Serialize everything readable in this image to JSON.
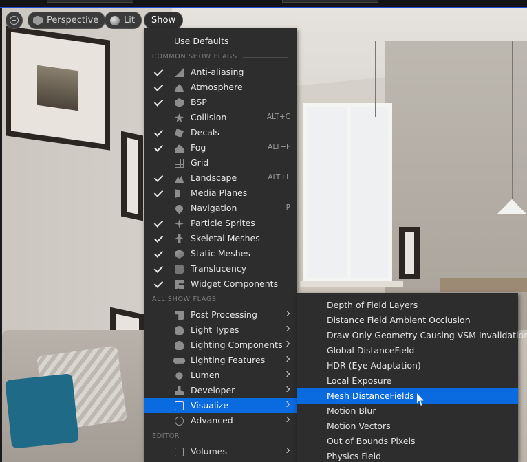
{
  "toolbar": {
    "perspective_label": "Perspective",
    "lit_label": "Lit",
    "show_label": "Show"
  },
  "menu": {
    "use_defaults": "Use Defaults",
    "section_common": "COMMON SHOW FLAGS",
    "common_items": [
      {
        "label": "Anti-aliasing",
        "checked": true,
        "shortcut": "",
        "icon": "anti-aliasing-icon"
      },
      {
        "label": "Atmosphere",
        "checked": true,
        "shortcut": "",
        "icon": "atmosphere-icon"
      },
      {
        "label": "BSP",
        "checked": true,
        "shortcut": "",
        "icon": "bsp-icon"
      },
      {
        "label": "Collision",
        "checked": false,
        "shortcut": "ALT+C",
        "icon": "collision-icon"
      },
      {
        "label": "Decals",
        "checked": true,
        "shortcut": "",
        "icon": "decals-icon"
      },
      {
        "label": "Fog",
        "checked": true,
        "shortcut": "ALT+F",
        "icon": "fog-icon"
      },
      {
        "label": "Grid",
        "checked": false,
        "shortcut": "",
        "icon": "grid-icon"
      },
      {
        "label": "Landscape",
        "checked": true,
        "shortcut": "ALT+L",
        "icon": "landscape-icon"
      },
      {
        "label": "Media Planes",
        "checked": true,
        "shortcut": "",
        "icon": "media-planes-icon"
      },
      {
        "label": "Navigation",
        "checked": false,
        "shortcut": "P",
        "icon": "navigation-icon"
      },
      {
        "label": "Particle Sprites",
        "checked": true,
        "shortcut": "",
        "icon": "particle-sprites-icon"
      },
      {
        "label": "Skeletal Meshes",
        "checked": true,
        "shortcut": "",
        "icon": "skeletal-meshes-icon"
      },
      {
        "label": "Static Meshes",
        "checked": true,
        "shortcut": "",
        "icon": "static-meshes-icon"
      },
      {
        "label": "Translucency",
        "checked": true,
        "shortcut": "",
        "icon": "translucency-icon"
      },
      {
        "label": "Widget Components",
        "checked": true,
        "shortcut": "",
        "icon": "widget-components-icon"
      }
    ],
    "section_all": "ALL SHOW FLAGS",
    "all_items": [
      {
        "label": "Post Processing",
        "icon": "post-processing-icon"
      },
      {
        "label": "Light Types",
        "icon": "light-types-icon"
      },
      {
        "label": "Lighting Components",
        "icon": "lighting-components-icon"
      },
      {
        "label": "Lighting Features",
        "icon": "lighting-features-icon"
      },
      {
        "label": "Lumen",
        "icon": "lumen-icon"
      },
      {
        "label": "Developer",
        "icon": "developer-icon"
      },
      {
        "label": "Visualize",
        "icon": "visualize-icon",
        "highlighted": true
      },
      {
        "label": "Advanced",
        "icon": "advanced-icon"
      }
    ],
    "section_editor": "EDITOR",
    "editor_items": [
      {
        "label": "Volumes",
        "icon": "volumes-icon"
      }
    ]
  },
  "submenu": {
    "items": [
      {
        "label": "Depth of Field Layers"
      },
      {
        "label": "Distance Field Ambient Occlusion"
      },
      {
        "label": "Draw Only Geometry Causing VSM Invalidation"
      },
      {
        "label": "Global DistanceField"
      },
      {
        "label": "HDR (Eye Adaptation)"
      },
      {
        "label": "Local Exposure"
      },
      {
        "label": "Mesh DistanceFields",
        "highlighted": true
      },
      {
        "label": "Motion Blur"
      },
      {
        "label": "Motion Vectors"
      },
      {
        "label": "Out of Bounds Pixels"
      },
      {
        "label": "Physics Field"
      }
    ]
  },
  "colors": {
    "menu_bg": "#2d2d2d",
    "highlight": "#0a6ae0",
    "text": "#e4e4e4",
    "section_text": "#7e7e7e",
    "viewport_border": "#1d4fd6"
  }
}
